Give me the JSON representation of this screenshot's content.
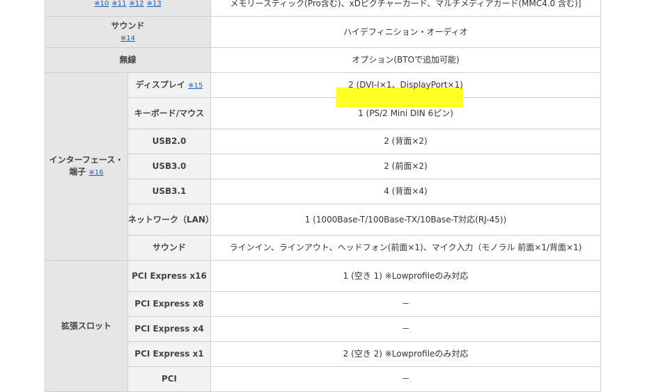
{
  "top_row": {
    "notes": [
      "※10",
      "※11",
      "※12",
      "※13"
    ],
    "value": "メモリースティック(Pro含む)、xDピクチャーカード、マルチメディアカード(MMC4.0 含む)]"
  },
  "sound_row": {
    "label": "サウンド",
    "note": "※14",
    "value": "ハイデフィニション・オーディオ"
  },
  "wireless_row": {
    "label": "無線",
    "value": "オプション(BTOで追加可能)"
  },
  "interface": {
    "label": "インターフェース・端子",
    "note": "※16",
    "rows": [
      {
        "label": "ディスプレイ",
        "note": "※15",
        "value": "2 (DVI-I×1、DisplayPort×1)"
      },
      {
        "label": "キーボード/マウス",
        "value": "1 (PS/2 Mini DIN 6ピン)"
      },
      {
        "label": "USB2.0",
        "value": "2 (背面×2)"
      },
      {
        "label": "USB3.0",
        "value": "2 (前面×2)"
      },
      {
        "label": "USB3.1",
        "value": "4 (背面×4)"
      },
      {
        "label": "ネットワーク（LAN）",
        "value": "1 (1000Base-T/100Base-TX/10Base-T対応(RJ-45))"
      },
      {
        "label": "サウンド",
        "value": "ラインイン、ラインアウト、ヘッドフォン(前面×1)、マイク入力（モノラル 前面×1/背面×1)"
      }
    ]
  },
  "expansion": {
    "label": "拡張スロット",
    "rows": [
      {
        "label": "PCI Express x16",
        "value": "1 (空き 1) ※Lowprofileのみ対応"
      },
      {
        "label": "PCI Express x8",
        "value": "－"
      },
      {
        "label": "PCI Express x4",
        "value": "－"
      },
      {
        "label": "PCI Express x1",
        "value": "2 (空き 2) ※Lowprofileのみ対応"
      },
      {
        "label": "PCI",
        "value": "－"
      }
    ]
  },
  "colors": {
    "link": "#1a5fb4",
    "header_bg": "#e6e6e6",
    "highlight": "#ffff00"
  }
}
